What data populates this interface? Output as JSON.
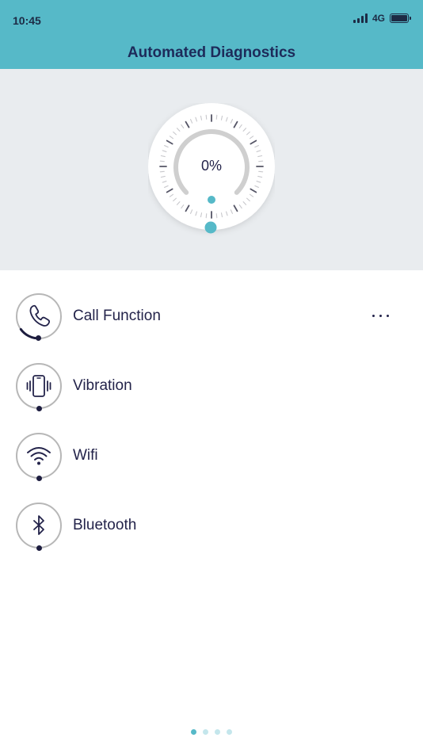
{
  "status_bar": {
    "time": "10:45",
    "network": "4G"
  },
  "header": {
    "title": "Automated Diagnostics"
  },
  "gauge": {
    "value_label": "0%",
    "progress": 0
  },
  "tests": [
    {
      "label": "Call Function",
      "icon": "phone-icon",
      "progress": 0.15,
      "has_more": true
    },
    {
      "label": "Vibration",
      "icon": "vibration-icon",
      "progress": 0,
      "has_more": false
    },
    {
      "label": "Wifi",
      "icon": "wifi-icon",
      "progress": 0,
      "has_more": false
    },
    {
      "label": "Bluetooth",
      "icon": "bluetooth-icon",
      "progress": 0,
      "has_more": false
    }
  ],
  "pagination": {
    "count": 4,
    "active": 0
  },
  "colors": {
    "accent": "#56b9c8",
    "text": "#23234a",
    "background": "#e9ecef"
  }
}
